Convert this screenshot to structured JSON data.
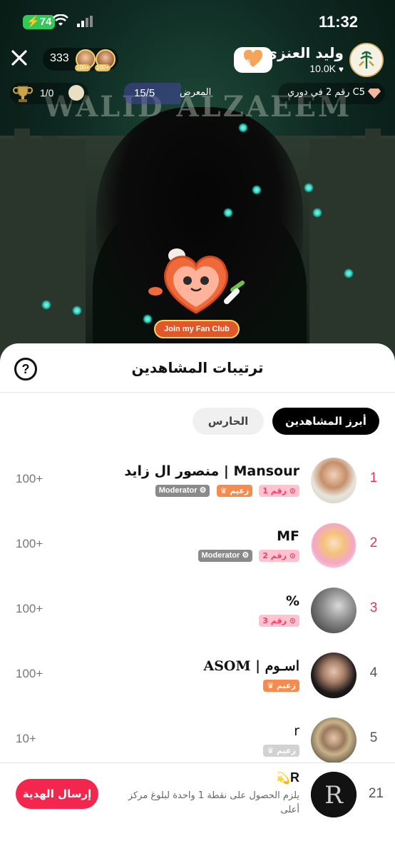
{
  "status_bar": {
    "battery": "74",
    "time": "11:32"
  },
  "stream": {
    "watermark": "WALID ALZAEEM",
    "viewer_count": "333",
    "top_viewer_badges": [
      "100+",
      "100+"
    ],
    "host": {
      "name": "وليد العنزي",
      "likes": "10.0K"
    },
    "fan_club_level": "5",
    "trophy_score": "1/0",
    "exhibit_count": "15/5",
    "exhibit_label": "المعرض",
    "league_text": "رقم 2 في دوري C5",
    "fan_club_promo": "Join my Fan Club"
  },
  "sheet": {
    "title": "ترتيبات المشاهدين",
    "help_label": "?",
    "tabs": [
      {
        "label": "أبرز المشاهدين",
        "active": true
      },
      {
        "label": "الحارس",
        "active": false
      }
    ],
    "rows": [
      {
        "rank": "1",
        "name": "منصور ال زايد | Mansour",
        "score": "100+",
        "badges": {
          "rank": "رقم 1",
          "zaeem": "زعيم",
          "mod": "Moderator"
        }
      },
      {
        "rank": "2",
        "name": "MF",
        "score": "100+",
        "badges": {
          "rank": "رقم 2",
          "mod": "Moderator"
        }
      },
      {
        "rank": "3",
        "name": "%",
        "score": "100+",
        "badges": {
          "rank": "رقم 3"
        }
      },
      {
        "rank": "4",
        "name": "ASOM | اسـوم",
        "score": "100+",
        "badges": {
          "zaeem": "زعيم"
        }
      },
      {
        "rank": "5",
        "name": "r",
        "score": "10+",
        "badges": {
          "zaeem": "زعيم"
        }
      }
    ],
    "self": {
      "rank": "21",
      "name": "R",
      "hint": "يلزم الحصول على نقطة 1 واحدة لبلوغ مركز أعلى",
      "gift_button": "إرسال الهدية"
    }
  },
  "colors": {
    "accent_red": "#f3264e",
    "rank_red": "#e8335a",
    "badge_pink": "#ffc2cf",
    "zaeem_orange": "#f58b4c"
  }
}
